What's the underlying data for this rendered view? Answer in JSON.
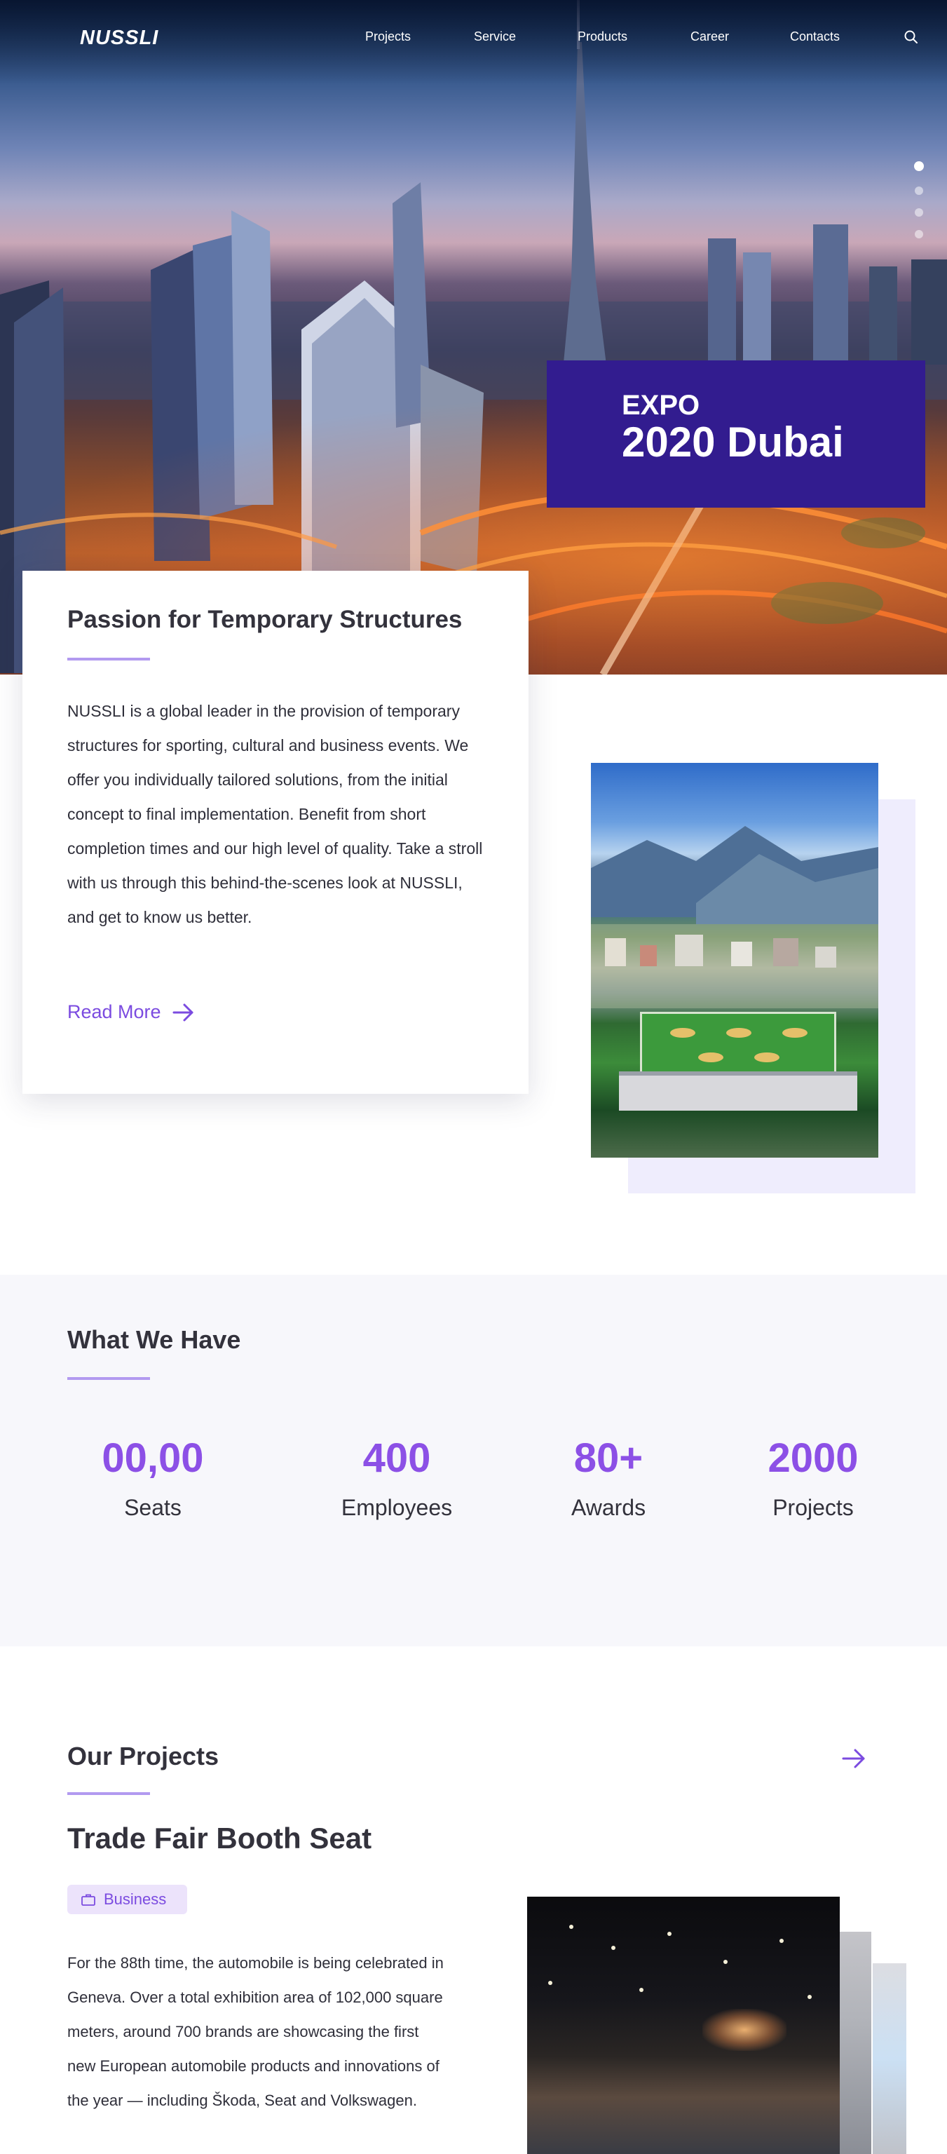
{
  "brand": {
    "logo_text": "NUSSLI"
  },
  "nav": {
    "items": [
      {
        "label": "Projects"
      },
      {
        "label": "Service"
      },
      {
        "label": "Products"
      },
      {
        "label": "Career"
      },
      {
        "label": "Contacts"
      }
    ],
    "search_icon": "search-icon"
  },
  "hero": {
    "slides_total": 4,
    "active_slide": 1,
    "expo_small": "EXPO",
    "expo_big": "2020 Dubai",
    "accent_color": "#321c8f"
  },
  "intro": {
    "title": "Passion for Temporary Structures",
    "body": "NUSSLI is a global leader in the provision of temporary structures for sporting, cultural and business events. We offer you individually tailored solutions, from the initial concept to final implementation. Benefit from short completion times and our high level of quality. Take a stroll with us through this behind-the-scenes look at NUSSLI, and get to know us better.",
    "read_more": "Read More"
  },
  "stats": {
    "title": "What We Have",
    "items": [
      {
        "value": "00,00",
        "label": "Seats"
      },
      {
        "value": "400",
        "label": "Employees"
      },
      {
        "value": "80+",
        "label": "Awards"
      },
      {
        "value": "2000",
        "label": "Projects"
      }
    ],
    "number_color": "#8c50e6"
  },
  "projects": {
    "title": "Our Projects",
    "featured": {
      "name": "Trade Fair Booth Seat",
      "badge": "Business",
      "body": "For the 88th time, the automobile is being celebrated in Geneva. Over a total exhibition area of 102,000 square meters, around 700 brands are showcasing the first new European automobile products and innovations of the year — including Škoda, Seat and Volkswagen."
    }
  }
}
